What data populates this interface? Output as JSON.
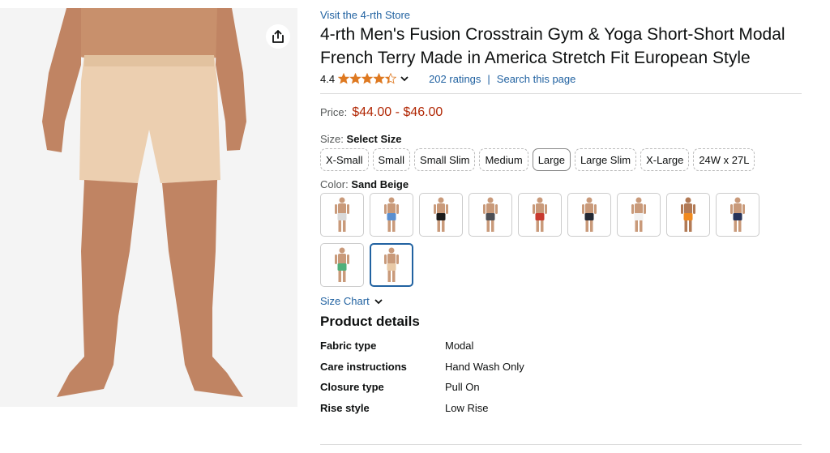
{
  "store_link": "Visit the 4-rth Store",
  "title": "4-rth Men's Fusion Crosstrain Gym & Yoga Short-Short Modal French Terry Made in America Stretch Fit European Style",
  "rating": {
    "value": "4.4",
    "stars_filled": 4.4,
    "count_text": "202 ratings",
    "separator": "|",
    "search_text": "Search this page"
  },
  "price": {
    "label": "Price:",
    "value": "$44.00 - $46.00"
  },
  "size": {
    "label": "Size:",
    "selected": "Select Size",
    "options": [
      "X-Small",
      "Small",
      "Small Slim",
      "Medium",
      "Large",
      "Large Slim",
      "X-Large",
      "24W x 27L"
    ]
  },
  "color": {
    "label": "Color:",
    "selected": "Sand Beige",
    "swatches": [
      {
        "name": "grey-model-standing",
        "shorts": "#d9d9d9",
        "skin": "#c99a7a"
      },
      {
        "name": "blue-model-stretching",
        "shorts": "#5a8fd0",
        "skin": "#c99a7a"
      },
      {
        "name": "black",
        "shorts": "#1b1b1b",
        "skin": "#c99a7a"
      },
      {
        "name": "charcoal",
        "shorts": "#4d4f55",
        "skin": "#c99a7a"
      },
      {
        "name": "red",
        "shorts": "#c8392e",
        "skin": "#c99a7a"
      },
      {
        "name": "navy-black",
        "shorts": "#232833",
        "skin": "#c99a7a"
      },
      {
        "name": "white",
        "shorts": "#f2f2f2",
        "skin": "#c99a7a"
      },
      {
        "name": "orange",
        "shorts": "#f08a1f",
        "skin": "#b27a55"
      },
      {
        "name": "navy",
        "shorts": "#27345a",
        "skin": "#c99a7a"
      },
      {
        "name": "green",
        "shorts": "#4fb07a",
        "skin": "#c99a7a"
      },
      {
        "name": "sand-beige",
        "shorts": "#e8c9a6",
        "skin": "#c99a7a"
      }
    ]
  },
  "size_chart": "Size Chart",
  "product_details": {
    "heading": "Product details",
    "rows": [
      {
        "key": "Fabric type",
        "value": "Modal"
      },
      {
        "key": "Care instructions",
        "value": "Hand Wash Only"
      },
      {
        "key": "Closure type",
        "value": "Pull On"
      },
      {
        "key": "Rise style",
        "value": "Low Rise"
      }
    ]
  },
  "colors": {
    "link": "#2162a1",
    "price": "#b12704",
    "star": "#de7921",
    "shorts_main": "#eccfb0",
    "skin": "#c8906c"
  }
}
